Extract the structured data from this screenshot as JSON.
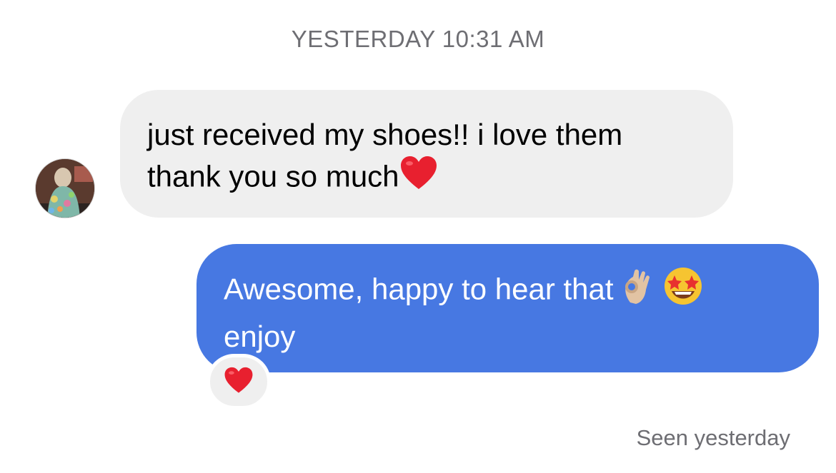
{
  "thread": {
    "timestamp": "YESTERDAY 10:31 AM",
    "messages": [
      {
        "direction": "incoming",
        "text": "just received my shoes!! i love them\nthank you so much",
        "trailing_emoji": "red-heart",
        "bubble_color": "#efefef"
      },
      {
        "direction": "outgoing",
        "text_line1": "Awesome, happy to hear that",
        "emojis": [
          "ok-hand",
          "star-struck"
        ],
        "text_line2": "enjoy",
        "bubble_color": "#4778e2",
        "reaction": "red-heart"
      }
    ],
    "read_receipt": "Seen yesterday"
  },
  "colors": {
    "outgoing_bubble": "#4778e2",
    "incoming_bubble": "#efefef",
    "muted_text": "#6e6e73",
    "heart": "#e8202f"
  }
}
